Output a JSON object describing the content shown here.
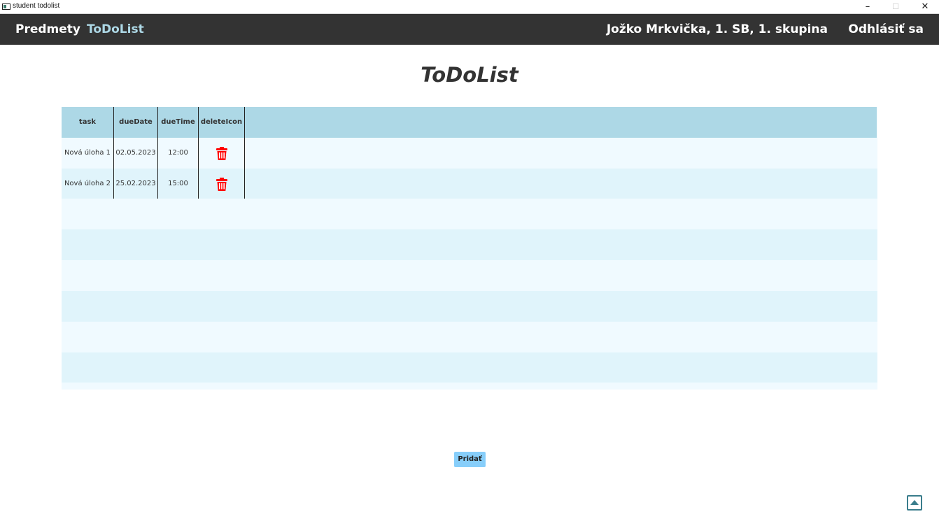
{
  "window": {
    "title": "student todolist",
    "minimize_glyph": "–",
    "maximize_glyph": "☐",
    "close_glyph": "✕"
  },
  "nav": {
    "items": [
      {
        "label": "Predmety"
      },
      {
        "label": "ToDoList",
        "active": true
      }
    ],
    "user": "Jožko Mrkvička, 1. SB, 1. skupina",
    "logout": "Odhlásiť sa",
    "active_color": "#add8e6"
  },
  "page": {
    "title": "ToDoList"
  },
  "table": {
    "columns": [
      "task",
      "dueDate",
      "dueTime",
      "deleteIcon"
    ],
    "rows": [
      {
        "task": "Nová úloha 1",
        "dueDate": "02.05.2023",
        "dueTime": "12:00",
        "icon": "trash-icon"
      },
      {
        "task": "Nová úloha 2",
        "dueDate": "25.02.2023",
        "dueTime": "15:00",
        "icon": "trash-icon"
      }
    ],
    "header_color": "#add8e6",
    "trash_color": "#ff0000"
  },
  "actions": {
    "add_label": "Pridať",
    "scroll_top_icon": "arrow-up-icon"
  }
}
